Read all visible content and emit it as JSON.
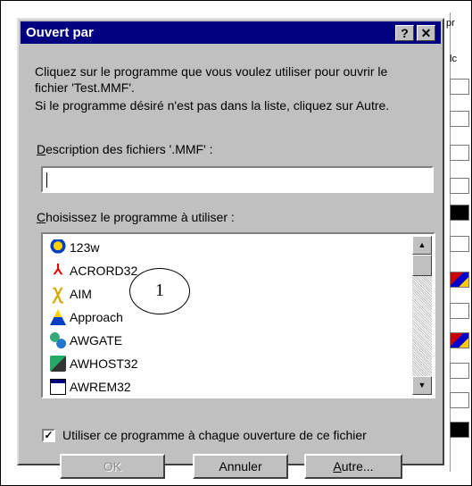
{
  "window": {
    "title": "Ouvert par",
    "help_label": "?",
    "close_label": "✕"
  },
  "instructions": {
    "line1": "Cliquez sur le programme que vous voulez utiliser pour ouvrir le",
    "line2": "fichier 'Test.MMF'.",
    "line3": "Si le programme désiré n'est pas dans la liste, cliquez sur Autre."
  },
  "description": {
    "label_first": "D",
    "label_rest": "escription des fichiers '.MMF' :",
    "value": ""
  },
  "program_list": {
    "label_first": "C",
    "label_rest": "hoisissez le programme à utiliser :",
    "items": [
      {
        "label": "123w",
        "icon": "123w-icon"
      },
      {
        "label": "ACRORD32",
        "icon": "acrobat-icon"
      },
      {
        "label": "AIM",
        "icon": "aim-icon"
      },
      {
        "label": "Approach",
        "icon": "approach-icon"
      },
      {
        "label": "AWGATE",
        "icon": "awgate-icon"
      },
      {
        "label": "AWHOST32",
        "icon": "awhost-icon"
      },
      {
        "label": "AWREM32",
        "icon": "awrem-icon"
      }
    ],
    "annotation": "1"
  },
  "always_use": {
    "checked": true,
    "label_before": "Utiliser ce programme à cha",
    "label_ul": "q",
    "label_after": "ue ouverture de ce fichier"
  },
  "buttons": {
    "ok": "OK",
    "cancel": "Annuler",
    "other_first": "A",
    "other_rest": "utre..."
  },
  "background_fragments": {
    "top_label": "pr",
    "second_label": "lc"
  }
}
